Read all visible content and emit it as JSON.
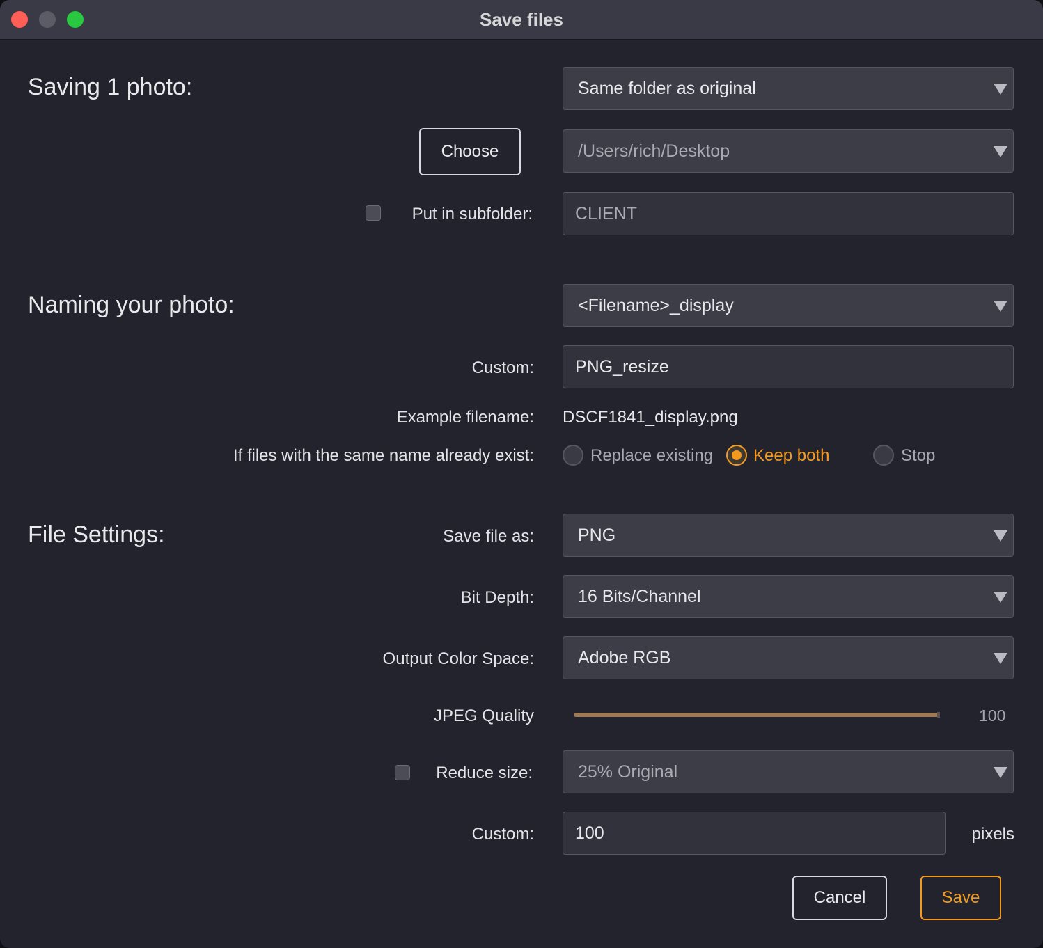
{
  "window": {
    "title": "Save files"
  },
  "sections": {
    "saving": "Saving 1 photo:",
    "naming": "Naming your photo:",
    "file_settings": "File Settings:"
  },
  "location": {
    "destination": "Same folder as original",
    "choose_label": "Choose",
    "path": "/Users/rich/Desktop",
    "subfolder_label": "Put in subfolder:",
    "subfolder_checked": false,
    "subfolder_value": "CLIENT"
  },
  "naming": {
    "template": "<Filename>_display",
    "custom_label": "Custom:",
    "custom_value": "PNG_resize",
    "example_label": "Example filename:",
    "example_value": "DSCF1841_display.png",
    "conflict_label": "If files with the same name already exist:",
    "conflict_options": [
      "Replace existing",
      "Keep both",
      "Stop"
    ],
    "conflict_selected": "Keep both"
  },
  "file_settings": {
    "format_label": "Save file as:",
    "format_value": "PNG",
    "bit_depth_label": "Bit Depth:",
    "bit_depth_value": "16 Bits/Channel",
    "color_space_label": "Output Color Space:",
    "color_space_value": "Adobe RGB",
    "jpeg_quality_label": "JPEG Quality",
    "jpeg_quality_value": "100",
    "reduce_label": "Reduce size:",
    "reduce_checked": false,
    "reduce_value": "25% Original",
    "custom_label": "Custom:",
    "custom_value": "100",
    "custom_unit": "pixels"
  },
  "actions": {
    "cancel": "Cancel",
    "save": "Save"
  },
  "colors": {
    "accent": "#f39a1e",
    "window_bg": "#22232d",
    "titlebar_bg": "#393a45",
    "field_bg": "#3c3d47",
    "slider_fill": "#9c7a56"
  }
}
